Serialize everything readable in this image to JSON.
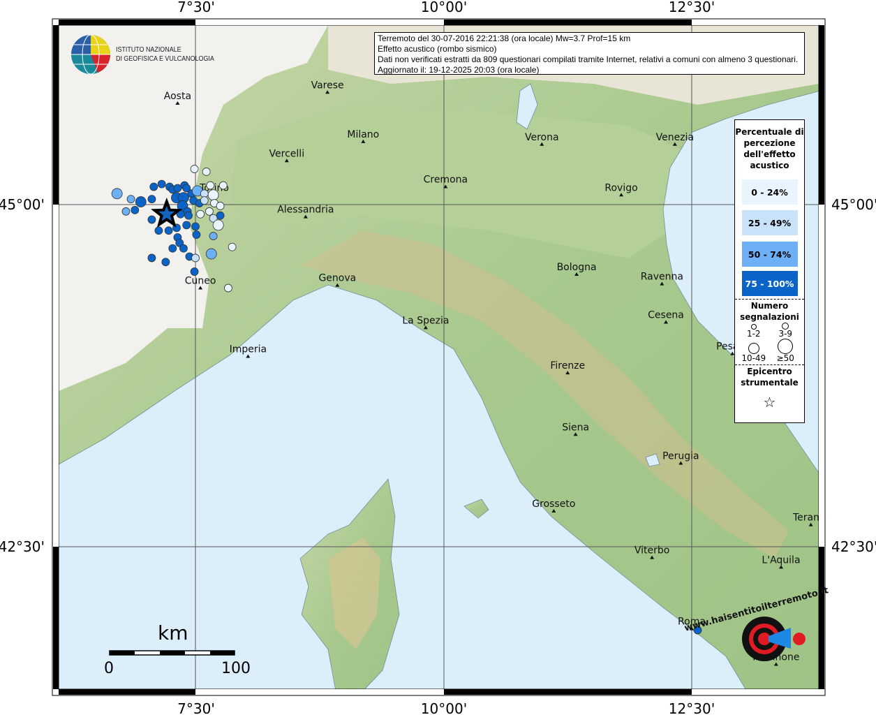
{
  "info": {
    "line1": "Terremoto del 30-07-2016 22:21:38 (ora locale) Mw=3.7 Prof=15 km",
    "line2": "Effetto acustico (rombo sismico)",
    "line3": "Dati non verificati estratti da 809 questionari compilati tramite Internet, relativi a comuni con almeno 3 questionari.",
    "line4": "Aggiornato il: 19-12-2025 20:03 (ora locale)"
  },
  "logo_ingv": {
    "line1": "ISTITUTO NAZIONALE",
    "line2": "DI GEOFISICA E VULCANOLOGIA"
  },
  "logo_hsit": "www.haisentitoilterremoto.it",
  "axes": {
    "lon_labels": [
      "7°30'",
      "10°00'",
      "12°30'"
    ],
    "lon_values": [
      7.5,
      10.0,
      12.5
    ],
    "lat_labels": [
      "45°00'",
      "42°30'"
    ],
    "lat_values": [
      45.0,
      42.5
    ]
  },
  "legend": {
    "title": "Percentuale di percezione dell'effetto acustico",
    "classes": [
      {
        "label": "0 - 24%",
        "color": "#e8f4fe"
      },
      {
        "label": "25 - 49%",
        "color": "#c8e2fa"
      },
      {
        "label": "50 - 74%",
        "color": "#6db0f6"
      },
      {
        "label": "75 - 100%",
        "color": "#0a64c8"
      }
    ],
    "count_title": "Numero segnalazioni",
    "sizes": [
      "1-2",
      "3-9",
      "10-49",
      "≥50"
    ],
    "epicenter_title": "Epicentro strumentale"
  },
  "scale": {
    "unit": "km",
    "min": "0",
    "max": "100"
  },
  "epicenter": {
    "lon": 7.21,
    "lat": 44.93
  },
  "cities": [
    {
      "name": "Aosta",
      "lon": 7.32,
      "lat": 45.74
    },
    {
      "name": "Varese",
      "lon": 8.83,
      "lat": 45.82
    },
    {
      "name": "Milano",
      "lon": 9.19,
      "lat": 45.46
    },
    {
      "name": "Vercelli",
      "lon": 8.42,
      "lat": 45.32
    },
    {
      "name": "Verona",
      "lon": 10.99,
      "lat": 45.44
    },
    {
      "name": "Venezia",
      "lon": 12.33,
      "lat": 45.44
    },
    {
      "name": "Torino",
      "lon": 7.69,
      "lat": 45.07
    },
    {
      "name": "Cremona",
      "lon": 10.02,
      "lat": 45.13
    },
    {
      "name": "Rovigo",
      "lon": 11.79,
      "lat": 45.07
    },
    {
      "name": "Alessandria",
      "lon": 8.61,
      "lat": 44.91
    },
    {
      "name": "Bologna",
      "lon": 11.34,
      "lat": 44.49
    },
    {
      "name": "Ravenna",
      "lon": 12.2,
      "lat": 44.42
    },
    {
      "name": "Genova",
      "lon": 8.93,
      "lat": 44.41
    },
    {
      "name": "Cuneo",
      "lon": 7.55,
      "lat": 44.39
    },
    {
      "name": "Cesena",
      "lon": 12.24,
      "lat": 44.14
    },
    {
      "name": "La Spezia",
      "lon": 9.82,
      "lat": 44.1
    },
    {
      "name": "Imperia",
      "lon": 8.03,
      "lat": 43.89
    },
    {
      "name": "Pesaro",
      "lon": 12.91,
      "lat": 43.91
    },
    {
      "name": "Firenze",
      "lon": 11.25,
      "lat": 43.77
    },
    {
      "name": "Siena",
      "lon": 11.33,
      "lat": 43.32
    },
    {
      "name": "Perugia",
      "lon": 12.39,
      "lat": 43.11
    },
    {
      "name": "Grosseto",
      "lon": 11.11,
      "lat": 42.76
    },
    {
      "name": "Teramo",
      "lon": 13.7,
      "lat": 42.66
    },
    {
      "name": "Viterbo",
      "lon": 12.1,
      "lat": 42.42
    },
    {
      "name": "L'Aquila",
      "lon": 13.4,
      "lat": 42.35
    },
    {
      "name": "Roma",
      "lon": 12.5,
      "lat": 41.9
    },
    {
      "name": "Frosinone",
      "lon": 13.35,
      "lat": 41.64
    }
  ],
  "points_fields": [
    "lon",
    "lat",
    "class_index",
    "size_index"
  ],
  "points": [
    [
      6.71,
      45.08,
      2,
      2
    ],
    [
      6.85,
      45.04,
      2,
      1
    ],
    [
      6.95,
      45.02,
      3,
      2
    ],
    [
      7.06,
      45.04,
      3,
      1
    ],
    [
      7.08,
      45.13,
      3,
      1
    ],
    [
      7.16,
      45.15,
      3,
      1
    ],
    [
      7.24,
      45.13,
      3,
      1
    ],
    [
      7.27,
      45.11,
      3,
      1
    ],
    [
      7.32,
      45.12,
      3,
      1
    ],
    [
      7.39,
      45.14,
      3,
      1
    ],
    [
      7.41,
      45.12,
      3,
      1
    ],
    [
      7.31,
      45.05,
      3,
      2
    ],
    [
      7.38,
      45.05,
      3,
      2
    ],
    [
      7.46,
      45.08,
      3,
      1
    ],
    [
      7.52,
      45.1,
      2,
      2
    ],
    [
      7.59,
      45.08,
      1,
      1
    ],
    [
      7.65,
      45.14,
      0,
      1
    ],
    [
      7.78,
      45.14,
      0,
      1
    ],
    [
      7.49,
      45.26,
      0,
      1
    ],
    [
      7.61,
      45.24,
      0,
      1
    ],
    [
      7.48,
      45.03,
      3,
      1
    ],
    [
      7.54,
      45.01,
      3,
      1
    ],
    [
      7.59,
      45.03,
      1,
      1
    ],
    [
      7.68,
      45.07,
      0,
      2
    ],
    [
      7.69,
      45.01,
      0,
      1
    ],
    [
      7.75,
      44.99,
      0,
      1
    ],
    [
      7.37,
      44.99,
      3,
      2
    ],
    [
      7.42,
      44.95,
      3,
      1
    ],
    [
      7.35,
      44.93,
      3,
      1
    ],
    [
      7.43,
      44.92,
      3,
      1
    ],
    [
      7.55,
      44.93,
      0,
      1
    ],
    [
      7.64,
      44.95,
      0,
      1
    ],
    [
      7.75,
      44.92,
      3,
      1
    ],
    [
      7.68,
      44.9,
      1,
      1
    ],
    [
      7.73,
      44.85,
      0,
      2
    ],
    [
      7.06,
      44.89,
      3,
      1
    ],
    [
      6.89,
      44.96,
      3,
      1
    ],
    [
      6.8,
      44.95,
      2,
      1
    ],
    [
      7.13,
      44.81,
      3,
      1
    ],
    [
      7.23,
      44.81,
      3,
      1
    ],
    [
      7.31,
      44.83,
      3,
      1
    ],
    [
      7.41,
      44.85,
      3,
      1
    ],
    [
      7.5,
      44.84,
      3,
      1
    ],
    [
      7.51,
      44.78,
      3,
      1
    ],
    [
      7.68,
      44.77,
      2,
      1
    ],
    [
      7.32,
      44.76,
      3,
      1
    ],
    [
      7.34,
      44.72,
      3,
      1
    ],
    [
      7.27,
      44.68,
      3,
      1
    ],
    [
      7.38,
      44.68,
      3,
      1
    ],
    [
      7.87,
      44.69,
      0,
      1
    ],
    [
      7.66,
      44.64,
      2,
      2
    ],
    [
      7.44,
      44.62,
      3,
      1
    ],
    [
      7.5,
      44.61,
      1,
      1
    ],
    [
      7.06,
      44.61,
      3,
      1
    ],
    [
      7.2,
      44.58,
      3,
      1
    ],
    [
      7.49,
      44.51,
      3,
      1
    ],
    [
      7.83,
      44.39,
      0,
      1
    ],
    [
      12.56,
      41.89,
      3,
      1
    ]
  ]
}
